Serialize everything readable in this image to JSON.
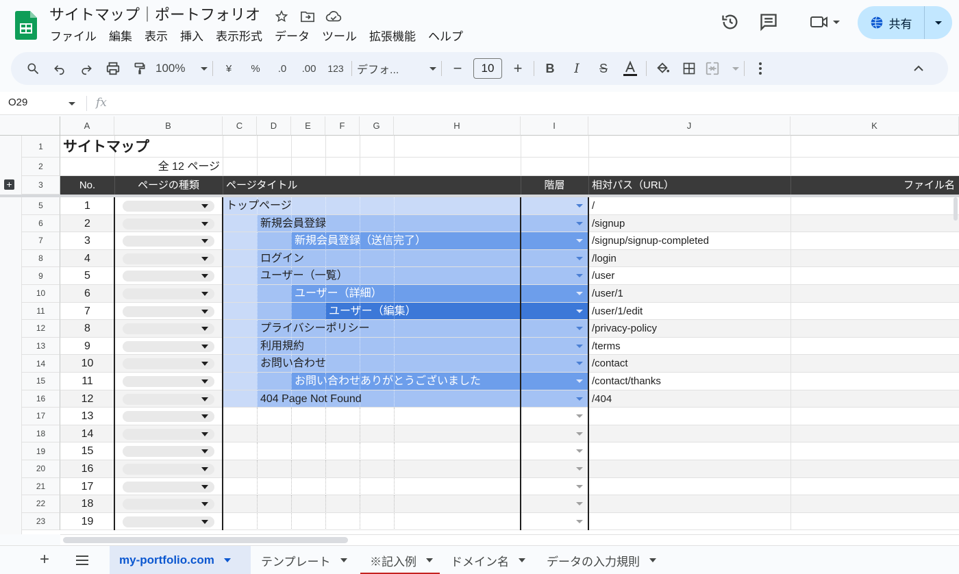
{
  "app": {
    "doc_title": "サイトマップ｜ポートフォリオ",
    "menu": [
      "ファイル",
      "編集",
      "表示",
      "挿入",
      "表示形式",
      "データ",
      "ツール",
      "拡張機能",
      "ヘルプ"
    ],
    "share_label": "共有"
  },
  "toolbar": {
    "zoom": "100%",
    "currency": "¥",
    "percent": "%",
    "dec_decrease": ".0",
    "dec_increase": ".00",
    "number_format": "123",
    "font": "デフォ...",
    "font_size": "10",
    "minus": "−",
    "plus": "+"
  },
  "formula_bar": {
    "name_box": "O29",
    "fx": "fx"
  },
  "columns": [
    "A",
    "B",
    "C",
    "D",
    "E",
    "F",
    "G",
    "H",
    "I",
    "J",
    "K"
  ],
  "sheet": {
    "title": "サイトマップ",
    "total": "全 12 ページ",
    "headers": {
      "no": "No.",
      "type": "ページの種類",
      "title": "ページタイトル",
      "level": "階層",
      "path": "相対パス（URL）",
      "file": "ファイル名"
    },
    "rows": [
      {
        "row": "5",
        "no": "1",
        "title": "トップページ",
        "level": 1,
        "path": "/"
      },
      {
        "row": "6",
        "no": "2",
        "title": "新規会員登録",
        "level": 2,
        "path": "/signup"
      },
      {
        "row": "7",
        "no": "3",
        "title": "新規会員登録（送信完了）",
        "level": 3,
        "path": "/signup/signup-completed"
      },
      {
        "row": "8",
        "no": "4",
        "title": "ログイン",
        "level": 2,
        "path": "/login"
      },
      {
        "row": "9",
        "no": "5",
        "title": "ユーザー（一覧）",
        "level": 2,
        "path": "/user"
      },
      {
        "row": "10",
        "no": "6",
        "title": "ユーザー（詳細）",
        "level": 3,
        "path": "/user/1"
      },
      {
        "row": "11",
        "no": "7",
        "title": "ユーザー（編集）",
        "level": 4,
        "path": "/user/1/edit"
      },
      {
        "row": "12",
        "no": "8",
        "title": "プライバシーポリシー",
        "level": 2,
        "path": "/privacy-policy"
      },
      {
        "row": "13",
        "no": "9",
        "title": "利用規約",
        "level": 2,
        "path": "/terms"
      },
      {
        "row": "14",
        "no": "10",
        "title": "お問い合わせ",
        "level": 2,
        "path": "/contact"
      },
      {
        "row": "15",
        "no": "11",
        "title": "お問い合わせありがとうございました",
        "level": 3,
        "path": "/contact/thanks"
      },
      {
        "row": "16",
        "no": "12",
        "title": "404 Page Not Found",
        "level": 2,
        "path": "/404"
      },
      {
        "row": "17",
        "no": "13",
        "title": "",
        "level": 0,
        "path": ""
      },
      {
        "row": "18",
        "no": "14",
        "title": "",
        "level": 0,
        "path": ""
      },
      {
        "row": "19",
        "no": "15",
        "title": "",
        "level": 0,
        "path": ""
      },
      {
        "row": "20",
        "no": "16",
        "title": "",
        "level": 0,
        "path": ""
      },
      {
        "row": "21",
        "no": "17",
        "title": "",
        "level": 0,
        "path": ""
      },
      {
        "row": "22",
        "no": "18",
        "title": "",
        "level": 0,
        "path": ""
      },
      {
        "row": "23",
        "no": "19",
        "title": "",
        "level": 0,
        "path": ""
      }
    ],
    "top_rows": [
      "1",
      "2",
      "3"
    ]
  },
  "level_colors": {
    "1": "#c9daf8",
    "2": "#a4c2f4",
    "3": "#6d9eeb",
    "4": "#3c78d8"
  },
  "tabs": [
    {
      "label": "my-portfolio.com",
      "active": true
    },
    {
      "label": "テンプレート",
      "active": false
    },
    {
      "label": "※記入例",
      "active": false
    },
    {
      "label": "ドメイン名",
      "active": false
    },
    {
      "label": "データの入力規則",
      "active": false
    }
  ]
}
